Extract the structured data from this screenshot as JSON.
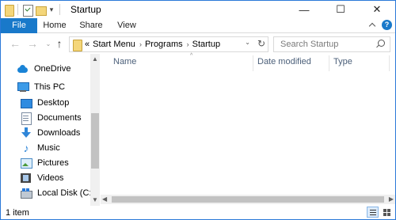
{
  "window": {
    "title": "Startup",
    "controls": {
      "minimize": "—",
      "maximize": "☐",
      "close": "✕"
    }
  },
  "ribbon": {
    "tabs": [
      "File",
      "Home",
      "Share",
      "View"
    ],
    "help": "?"
  },
  "address": {
    "prefix": "«",
    "crumbs": [
      "Start Menu",
      "Programs",
      "Startup"
    ],
    "separator": "›",
    "dropdown": "⌄",
    "refresh": "↻"
  },
  "nav_buttons": {
    "back": "←",
    "forward": "→",
    "recent": "⌄",
    "up": "↑"
  },
  "search": {
    "placeholder": "Search Startup"
  },
  "nav_pane": {
    "items": [
      {
        "label": "OneDrive",
        "icon": "onedrive-icon"
      },
      {
        "label": "This PC",
        "icon": "this-pc-icon"
      },
      {
        "label": "Desktop",
        "icon": "desktop-icon"
      },
      {
        "label": "Documents",
        "icon": "documents-icon"
      },
      {
        "label": "Downloads",
        "icon": "downloads-icon"
      },
      {
        "label": "Music",
        "icon": "music-icon"
      },
      {
        "label": "Pictures",
        "icon": "pictures-icon"
      },
      {
        "label": "Videos",
        "icon": "videos-icon"
      },
      {
        "label": "Local Disk (C:)",
        "icon": "local-disk-icon"
      }
    ]
  },
  "content": {
    "columns": [
      "Name",
      "Date modified",
      "Type"
    ],
    "sort_indicator": "^"
  },
  "status": {
    "text": "1 item"
  },
  "scroll": {
    "up": "▲",
    "down": "▼",
    "left": "◀",
    "right": "▶"
  },
  "colors": {
    "accent": "#1979ca",
    "column_header_text": "#4c607a",
    "border": "#2b79d8"
  }
}
